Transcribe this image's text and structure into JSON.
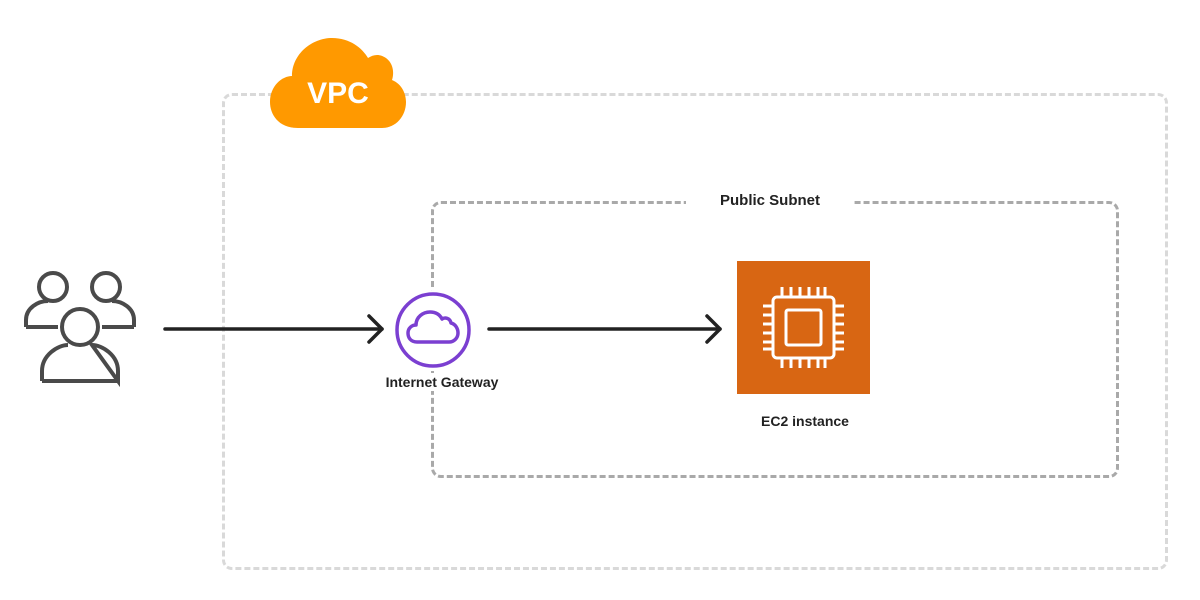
{
  "diagram": {
    "vpc": {
      "label": "VPC",
      "color": "#FF9900"
    },
    "subnet": {
      "label": "Public Subnet"
    },
    "nodes": {
      "users": {
        "icon": "users-icon",
        "color": "#4a4a4a"
      },
      "internet_gateway": {
        "label": "Internet Gateway",
        "icon": "cloud-icon",
        "color": "#7B3FD1"
      },
      "ec2": {
        "label": "EC2 instance",
        "icon": "chip-icon",
        "color": "#D86613"
      }
    },
    "edges": [
      {
        "from": "users",
        "to": "internet_gateway"
      },
      {
        "from": "internet_gateway",
        "to": "ec2"
      }
    ]
  }
}
